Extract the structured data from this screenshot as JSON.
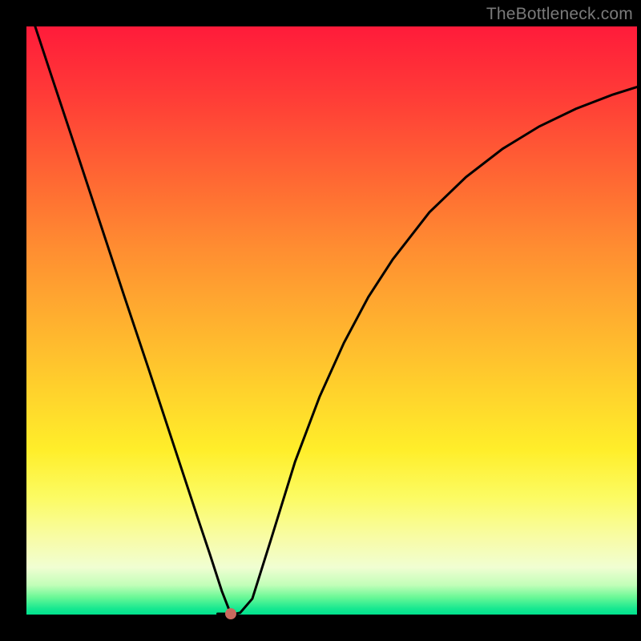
{
  "watermark": "TheBottleneck.com",
  "marker": {
    "x_pct": 33.5,
    "y_pct": 99.8,
    "color": "#c96a5e"
  },
  "chart_data": {
    "type": "line",
    "title": "",
    "xlabel": "",
    "ylabel": "",
    "x": [
      0.0,
      0.04,
      0.08,
      0.12,
      0.16,
      0.2,
      0.24,
      0.28,
      0.3,
      0.32,
      0.335,
      0.35,
      0.37,
      0.4,
      0.44,
      0.48,
      0.52,
      0.56,
      0.6,
      0.66,
      0.72,
      0.78,
      0.84,
      0.9,
      0.96,
      1.0
    ],
    "y": [
      1.045,
      0.919,
      0.794,
      0.668,
      0.542,
      0.418,
      0.292,
      0.166,
      0.104,
      0.04,
      0.0,
      0.003,
      0.027,
      0.126,
      0.26,
      0.37,
      0.462,
      0.54,
      0.604,
      0.684,
      0.744,
      0.792,
      0.83,
      0.86,
      0.884,
      0.897
    ],
    "xlim": [
      0,
      1
    ],
    "ylim": [
      0,
      1
    ],
    "annotations": [],
    "note": "x and y are normalized to the plot area (0 = left/bottom, 1 = right/top); y measured from bottom, values >1 indicate the curve begins above the visible top edge."
  }
}
